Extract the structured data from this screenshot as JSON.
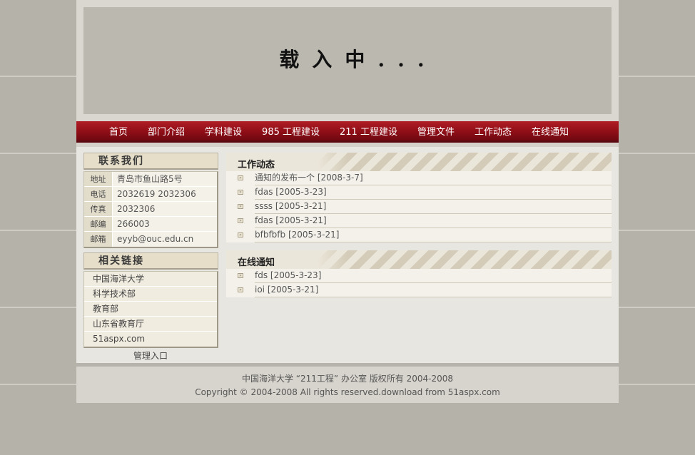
{
  "banner": {
    "loading_text": "载入中..."
  },
  "nav": {
    "items": [
      {
        "label": "首页"
      },
      {
        "label": "部门介绍"
      },
      {
        "label": "学科建设"
      },
      {
        "label": "985 工程建设"
      },
      {
        "label": "211 工程建设"
      },
      {
        "label": "管理文件"
      },
      {
        "label": "工作动态"
      },
      {
        "label": "在线通知"
      }
    ]
  },
  "contact": {
    "title": "联系我们",
    "rows": [
      {
        "key": "地址",
        "value": "青岛市鱼山路5号"
      },
      {
        "key": "电话",
        "value": "2032619  2032306"
      },
      {
        "key": "传真",
        "value": "2032306"
      },
      {
        "key": "邮编",
        "value": "266003"
      },
      {
        "key": "邮箱",
        "value": "eyyb@ouc.edu.cn"
      }
    ]
  },
  "links": {
    "title": "相关链接",
    "items": [
      {
        "label": "中国海洋大学"
      },
      {
        "label": "科学技术部"
      },
      {
        "label": "教育部"
      },
      {
        "label": "山东省教育厅"
      },
      {
        "label": "51aspx.com"
      }
    ],
    "admin_label": "管理入口"
  },
  "work_news": {
    "title": "工作动态",
    "items": [
      {
        "text": "通知的发布一个  [2008-3-7]"
      },
      {
        "text": "fdas  [2005-3-23]"
      },
      {
        "text": "ssss  [2005-3-21]"
      },
      {
        "text": "fdas  [2005-3-21]"
      },
      {
        "text": "bfbfbfb  [2005-3-21]"
      }
    ]
  },
  "online_notice": {
    "title": "在线通知",
    "items": [
      {
        "text": "fds  [2005-3-23]"
      },
      {
        "text": "ioi  [2005-3-21]"
      }
    ]
  },
  "footer": {
    "line1": "中国海洋大学 “211工程” 办公室  版权所有  2004-2008",
    "line2": "Copyright © 2004-2008 All rights reserved.download from 51aspx.com"
  },
  "colors": {
    "nav_red": "#8f0e17",
    "page_bg": "#e8e6e0",
    "outer_bg": "#b5b2aa"
  }
}
